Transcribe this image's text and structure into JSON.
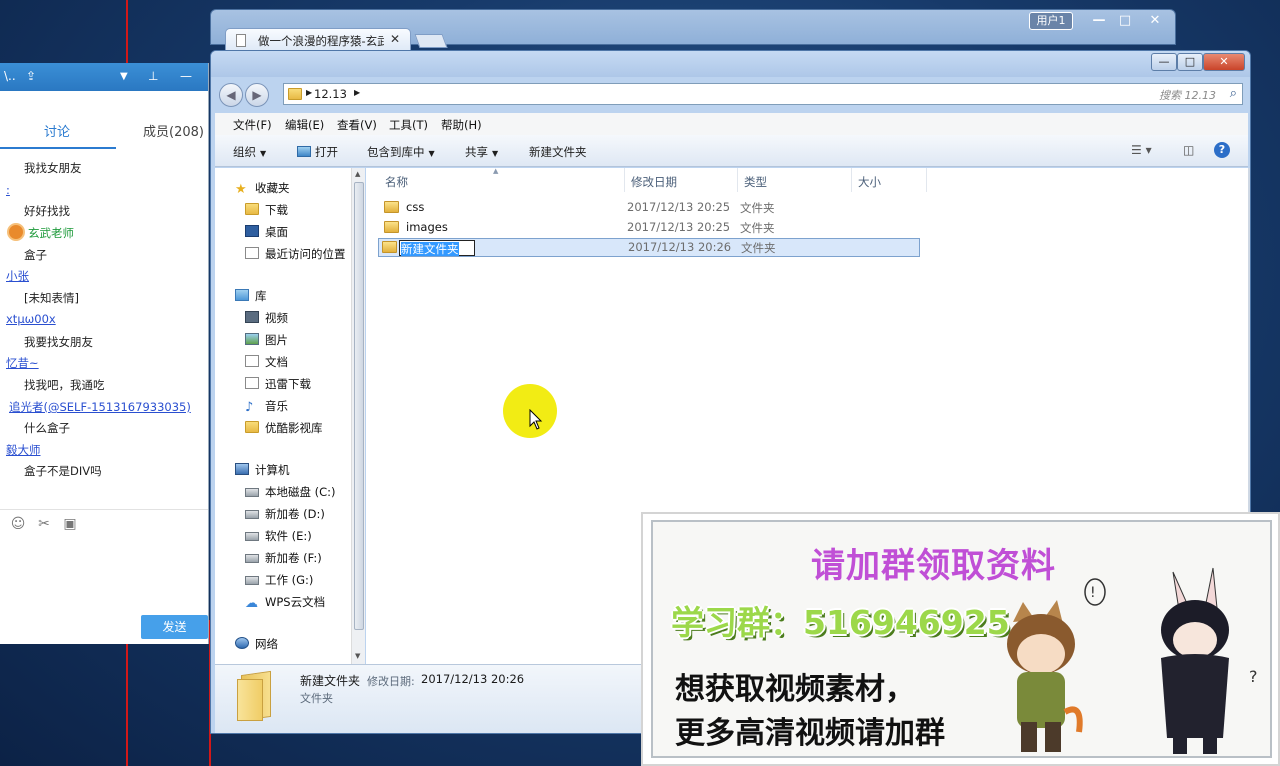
{
  "chat": {
    "tab_discuss": "讨论",
    "tab_members": "成员(208)",
    "messages": [
      {
        "type": "text",
        "text": "我找女朋友"
      },
      {
        "type": "sender",
        "text": ":"
      },
      {
        "type": "text",
        "text": "好好找找"
      },
      {
        "type": "sender_green",
        "text": "玄武老师"
      },
      {
        "type": "text",
        "text": "盒子"
      },
      {
        "type": "sender",
        "text": "小张"
      },
      {
        "type": "text",
        "text": "[未知表情]"
      },
      {
        "type": "sender",
        "text": "xtµω00x"
      },
      {
        "type": "text",
        "text": "我要找女朋友"
      },
      {
        "type": "sender",
        "text": "忆昔~"
      },
      {
        "type": "text",
        "text": "找我吧，我通吃"
      },
      {
        "type": "sender",
        "text": "追光者(@SELF-1513167933035)"
      },
      {
        "type": "text",
        "text": "什么盒子"
      },
      {
        "type": "sender",
        "text": "毅大师"
      },
      {
        "type": "text",
        "text": "盒子不是DIV吗"
      }
    ],
    "send_label": "发送"
  },
  "browser": {
    "tab_title": "做一个浪漫的程序猿-玄武",
    "user_label": "用户1"
  },
  "explorer": {
    "address_crumb": "12.13",
    "search_placeholder": "搜索 12.13",
    "menu": [
      "文件(F)",
      "编辑(E)",
      "查看(V)",
      "工具(T)",
      "帮助(H)"
    ],
    "commands": {
      "organize": "组织",
      "open": "打开",
      "include_library": "包含到库中",
      "share": "共享",
      "new_folder": "新建文件夹"
    },
    "nav": {
      "favorites": "收藏夹",
      "downloads": "下载",
      "desktop": "桌面",
      "recent": "最近访问的位置",
      "libraries": "库",
      "videos": "视频",
      "pictures": "图片",
      "documents": "文档",
      "thunder": "迅雷下载",
      "music": "音乐",
      "youku": "优酷影视库",
      "computer": "计算机",
      "drive_c": "本地磁盘 (C:)",
      "drive_d": "新加卷 (D:)",
      "drive_e": "软件 (E:)",
      "drive_f": "新加卷 (F:)",
      "drive_g": "工作 (G:)",
      "wps_cloud": "WPS云文档",
      "network": "网络"
    },
    "columns": {
      "name": "名称",
      "modified": "修改日期",
      "type": "类型",
      "size": "大小"
    },
    "files": [
      {
        "name": "css",
        "modified": "2017/12/13 20:25",
        "type": "文件夹"
      },
      {
        "name": "images",
        "modified": "2017/12/13 20:25",
        "type": "文件夹"
      },
      {
        "name": "新建文件夹",
        "modified": "2017/12/13 20:26",
        "type": "文件夹"
      }
    ],
    "details": {
      "name": "新建文件夹",
      "modified_label": "修改日期:",
      "modified": "2017/12/13 20:26",
      "type": "文件夹"
    }
  },
  "ad": {
    "title": "请加群领取资料",
    "group": "学习群：516946925",
    "line1": "想获取视频素材，",
    "line2": "更多高清视频请加群"
  }
}
